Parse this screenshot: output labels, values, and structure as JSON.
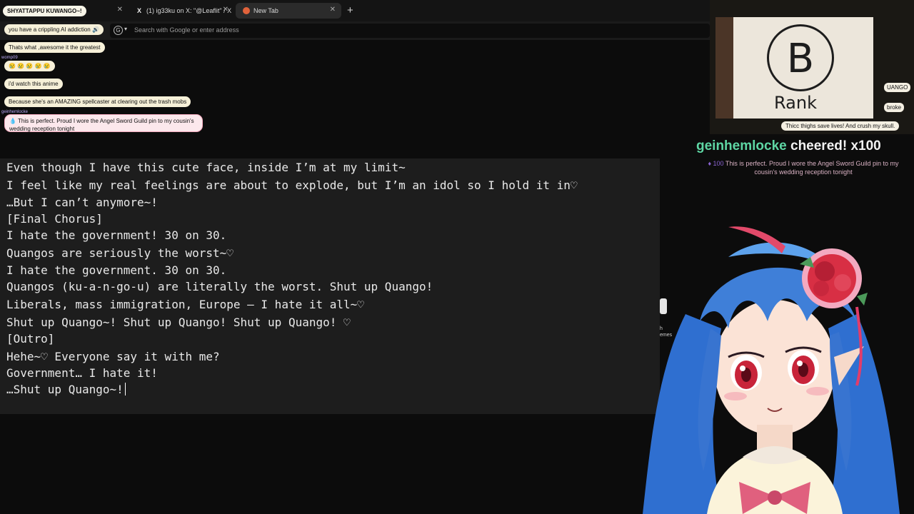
{
  "browser": {
    "tabs": [
      {
        "title": "",
        "active": false
      },
      {
        "title": "(1) ig33ku on X: \"@Leaflit\" / X",
        "active": false
      },
      {
        "title": "New Tab",
        "active": true
      }
    ],
    "address_placeholder": "Search with Google or enter address"
  },
  "chat": {
    "header": "SHYATTAPPU KUWANGO~!",
    "messages": [
      {
        "user": "",
        "text": "you have a crippling AI addiction 🔊"
      },
      {
        "user": "",
        "text": "Thats what ,awesome it the greatest"
      },
      {
        "user": "womp09",
        "text": "😢 😢 😢 😢 😢"
      },
      {
        "user": "",
        "text": "i'd watch this anime"
      },
      {
        "user": "",
        "text": "Because she's an AMAZING spellcaster at clearing out the trash mobs"
      },
      {
        "user": "geinhemlocke",
        "text": "💧 This is perfect. Proud I wore the Angel Sword Guild pin to my cousin's wedding reception tonight"
      }
    ]
  },
  "editor": {
    "lines": [
      "Even though I have this cute face, inside I’m at my limit~",
      "I feel like my real feelings are about to explode, but I’m an idol so I hold it in♡",
      "…But I can’t anymore~!",
      "[Final Chorus]",
      "I hate the government! 30 on 30.",
      "Quangos are seriously the worst~♡",
      "I hate the government. 30 on 30.",
      "Quangos (ku-a-n-go-u) are literally the worst. Shut up Quango!",
      "Liberals, mass immigration, Europe — I hate it all~♡",
      "Shut up Quango~! Shut up Quango! Shut up Quango! ♡",
      "[Outro]",
      "Hehe~♡ Everyone say it with me?",
      "Government… I hate it!",
      "…Shut up Quango~!"
    ]
  },
  "webcam": {
    "rank_letter": "B",
    "rank_word": "Rank",
    "overlay_message": "Thicc thighs save lives! And crush my skull.",
    "side_chips": [
      "UANGO",
      "broke"
    ]
  },
  "cheer": {
    "user": "geinhemlocke",
    "text": "cheered! x100",
    "amount": "100",
    "message": "This is perfect. Proud I wore the Angel Sword Guild pin to my cousin's wedding reception tonight"
  },
  "side_label": "h\nemes",
  "colors": {
    "cheer_user": "#5ed6a4",
    "chat_bubble": "#f6f0d8",
    "highlight_border": "#f3a9bd",
    "avatar_hair": "#3f7fd8",
    "avatar_eyes": "#c8243a"
  }
}
